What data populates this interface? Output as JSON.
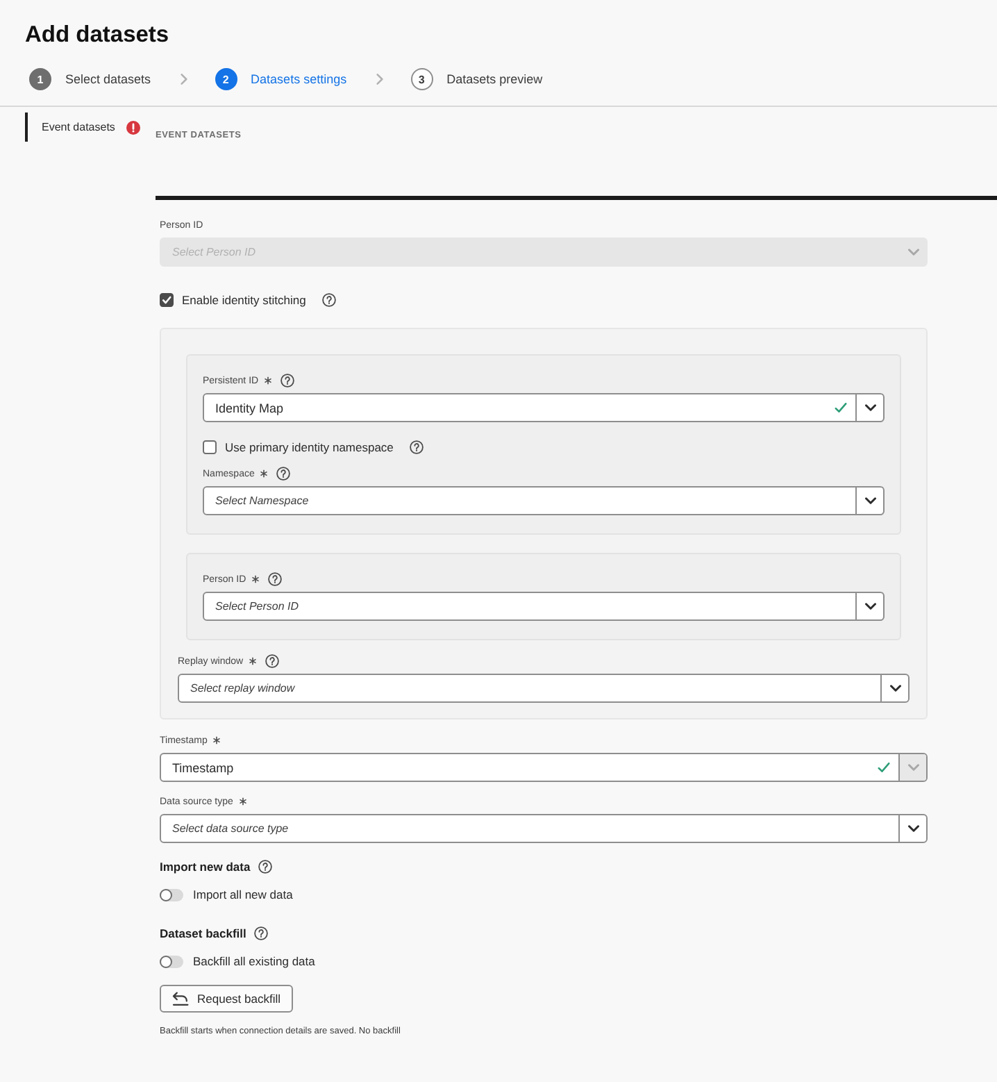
{
  "page": {
    "title": "Add datasets"
  },
  "steps": [
    {
      "number": "1",
      "label": "Select datasets",
      "completed": true,
      "selected": false
    },
    {
      "number": "2",
      "label": "Datasets settings",
      "completed": false,
      "selected": true
    },
    {
      "number": "3",
      "label": "Datasets preview",
      "completed": false,
      "selected": false
    }
  ],
  "sidebar": {
    "items": [
      {
        "label": "Event datasets",
        "selected": true,
        "error": true
      }
    ]
  },
  "section": {
    "heading": "EVENT DATASETS"
  },
  "form": [
    {
      "kind": "select",
      "label": "Person ID",
      "required": false,
      "help": false,
      "placeholder": "Select Person ID",
      "disabled": true,
      "valid": false,
      "menu_disabled": false
    },
    {
      "kind": "checkbox",
      "label": "Enable identity stitching",
      "checked": true,
      "help": true
    },
    {
      "kind": "panel",
      "children": [
        {
          "kind": "panel",
          "children": [
            {
              "kind": "select",
              "label": "Persistent ID",
              "required": true,
              "help": true,
              "value": "Identity Map",
              "disabled": false,
              "valid": true,
              "menu_disabled": false
            },
            {
              "kind": "checkbox",
              "label": "Use primary identity namespace",
              "checked": false,
              "help": true
            },
            {
              "kind": "select",
              "label": "Namespace",
              "required": true,
              "help": true,
              "placeholder": "Select Namespace",
              "disabled": false,
              "valid": false,
              "menu_disabled": false
            }
          ]
        },
        {
          "kind": "panel",
          "children": [
            {
              "kind": "select",
              "label": "Person ID",
              "required": true,
              "help": true,
              "placeholder": "Select Person ID",
              "disabled": false,
              "valid": false,
              "menu_disabled": false
            }
          ]
        },
        {
          "kind": "select",
          "label": "Replay window",
          "required": true,
          "help": true,
          "placeholder": "Select replay window",
          "disabled": false,
          "valid": false,
          "menu_disabled": false
        }
      ]
    },
    {
      "kind": "select",
      "label": "Timestamp",
      "required": true,
      "help": false,
      "value": "Timestamp",
      "disabled": false,
      "valid": true,
      "menu_disabled": true
    },
    {
      "kind": "select",
      "label": "Data source type",
      "required": true,
      "help": false,
      "placeholder": "Select data source type",
      "disabled": false,
      "valid": false,
      "menu_disabled": false
    },
    {
      "kind": "heading",
      "text": "Import new data",
      "help": true
    },
    {
      "kind": "toggle",
      "label": "Import all new data",
      "on": false
    },
    {
      "kind": "heading",
      "text": "Dataset backfill",
      "help": true
    },
    {
      "kind": "toggle",
      "label": "Backfill all existing data",
      "on": false
    },
    {
      "kind": "button",
      "label": "Request backfill"
    },
    {
      "kind": "note",
      "text": "Backfill starts when connection details are saved. No backfill"
    }
  ]
}
